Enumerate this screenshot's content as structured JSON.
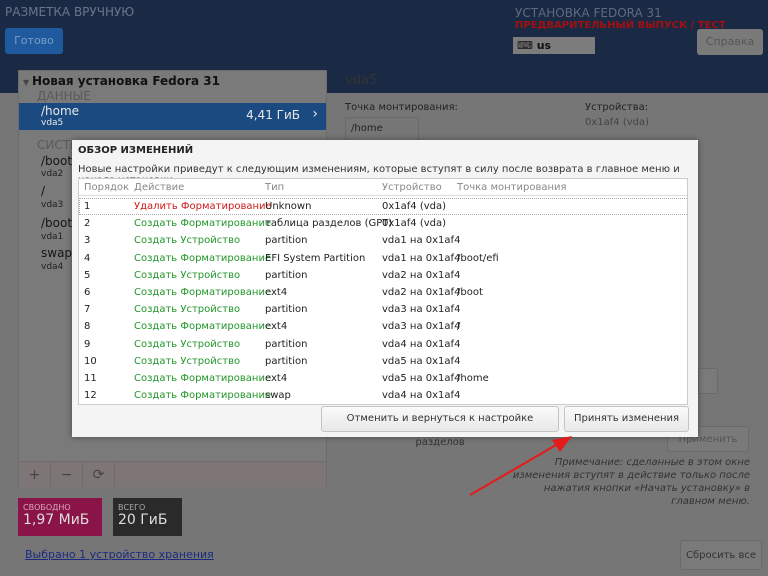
{
  "header": {
    "title": "РАЗМЕТКА ВРУЧНУЮ",
    "done_label": "Готово",
    "install_title": "УСТАНОВКА FEDORA 31",
    "prerelease": "ПРЕДВАРИТЕЛЬНЫЙ ВЫПУСК / ТЕСТ",
    "keyboard": "us",
    "help_label": "Справка"
  },
  "left": {
    "root": "Новая установка Fedora 31",
    "data_section": "ДАННЫЕ",
    "selected": {
      "mount": "/home",
      "dev": "vda5",
      "size": "4,41 ГиБ"
    },
    "system_section": "СИСТЕМА",
    "items": [
      {
        "mount": "/boot",
        "dev": "vda2"
      },
      {
        "mount": "/",
        "dev": "vda3"
      },
      {
        "mount": "/boot/efi",
        "dev": "vda1"
      },
      {
        "mount": "swap",
        "dev": "vda4"
      }
    ],
    "tools": [
      "+",
      "−",
      "⟳"
    ],
    "free_label": "СВОБОДНО",
    "free_value": "1,97 МиБ",
    "total_label": "ВСЕГО",
    "total_value": "20 ГиБ",
    "storage_link": "Выбрано 1 устройство хранения"
  },
  "right": {
    "title": "vda5",
    "mount_label": "Точка монтирования:",
    "mount_value": "/home",
    "devices_label": "Устройства:",
    "devices_value": "0x1af4 (vda)",
    "apply_label": "Применить",
    "note": "Примечание:  сделанные в этом окне изменения вступят в действие только после нажатия кнопки «Начать установку» в главном меню.",
    "reset_label": "Сбросить все"
  },
  "dialog": {
    "title": "ОБЗОР ИЗМЕНЕНИЙ",
    "description": "Новые настройки приведут к следующим изменениям, которые вступят в силу после возврата в главное меню и начала установки:",
    "columns": [
      "Порядок",
      "Действие",
      "Тип",
      "Устройство",
      "Точка монтирования"
    ],
    "rows": [
      [
        "1",
        "Удалить Форматирование",
        "Unknown",
        "0x1af4 (vda)",
        ""
      ],
      [
        "2",
        "Создать Форматирование",
        "таблица разделов (GPT)",
        "0x1af4 (vda)",
        ""
      ],
      [
        "3",
        "Создать Устройство",
        "partition",
        "vda1 на 0x1af4",
        ""
      ],
      [
        "4",
        "Создать Форматирование",
        "EFI System Partition",
        "vda1 на 0x1af4",
        "/boot/efi"
      ],
      [
        "5",
        "Создать Устройство",
        "partition",
        "vda2 на 0x1af4",
        ""
      ],
      [
        "6",
        "Создать Форматирование",
        "ext4",
        "vda2 на 0x1af4",
        "/boot"
      ],
      [
        "7",
        "Создать Устройство",
        "partition",
        "vda3 на 0x1af4",
        ""
      ],
      [
        "8",
        "Создать Форматирование",
        "ext4",
        "vda3 на 0x1af4",
        "/"
      ],
      [
        "9",
        "Создать Устройство",
        "partition",
        "vda4 на 0x1af4",
        ""
      ],
      [
        "10",
        "Создать Устройство",
        "partition",
        "vda5 на 0x1af4",
        ""
      ],
      [
        "11",
        "Создать Форматирование",
        "ext4",
        "vda5 на 0x1af4",
        "/home"
      ],
      [
        "12",
        "Создать Форматирование",
        "swap",
        "vda4 на 0x1af4",
        ""
      ]
    ],
    "cancel_label": "Отменить и вернуться к настройке разделов",
    "accept_label": "Принять изменения"
  }
}
